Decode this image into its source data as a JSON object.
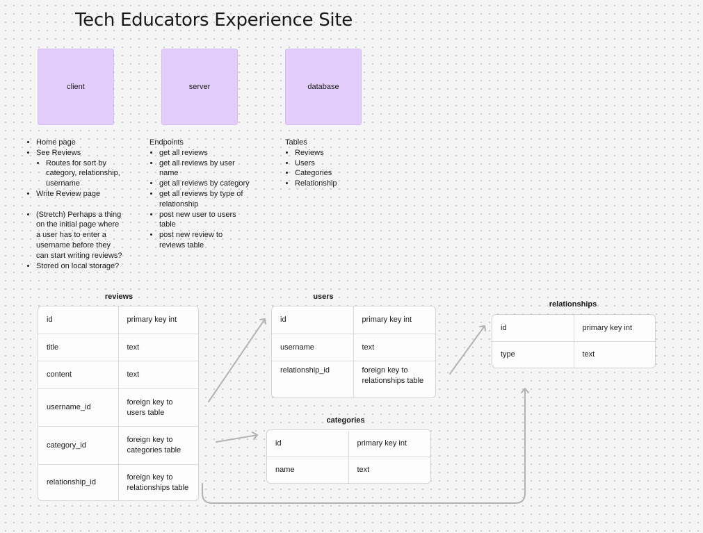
{
  "title": "Tech Educators Experience Site",
  "boxes": {
    "client": "client",
    "server": "server",
    "database": "database"
  },
  "client_notes": {
    "home": "Home page",
    "see_reviews": "See Reviews",
    "routes": "Routes for sort by category, relationship, username",
    "write": "Write Review page",
    "stretch": "(Stretch) Perhaps a thing on the initial page where a user has to enter a username before they can start writing reviews?",
    "stored": "Stored on local storage?"
  },
  "server_notes": {
    "heading": "Endpoints",
    "items": [
      "get all reviews",
      "get all reviews by user name",
      "get all reviews by category",
      "get all reviews by type of relationship",
      "post new user to users table",
      "post new review to reviews table"
    ]
  },
  "database_notes": {
    "heading": "Tables",
    "items": [
      "Reviews",
      "Users",
      "Categories",
      "Relationship"
    ]
  },
  "tables": {
    "reviews": {
      "name": "reviews",
      "rows": [
        [
          "id",
          "primary key int"
        ],
        [
          "title",
          "text"
        ],
        [
          "content",
          "text"
        ],
        [
          "username_id",
          "foreign key to users table"
        ],
        [
          "category_id",
          "foreign key to categories table"
        ],
        [
          "relationship_id",
          "foreign key to relationships table"
        ]
      ]
    },
    "users": {
      "name": "users",
      "rows": [
        [
          "id",
          "primary key int"
        ],
        [
          "username",
          "text"
        ],
        [
          "relationship_id",
          "foreign key to relationships table"
        ]
      ]
    },
    "categories": {
      "name": "categories",
      "rows": [
        [
          "id",
          "primary key int"
        ],
        [
          "name",
          "text"
        ]
      ]
    },
    "relationships": {
      "name": "relationships",
      "rows": [
        [
          "id",
          "primary key int"
        ],
        [
          "type",
          "text"
        ]
      ]
    }
  },
  "colors": {
    "box_fill": "#e3cdfa",
    "arrow": "#b3b3b3",
    "background": "#f5f5f5"
  }
}
